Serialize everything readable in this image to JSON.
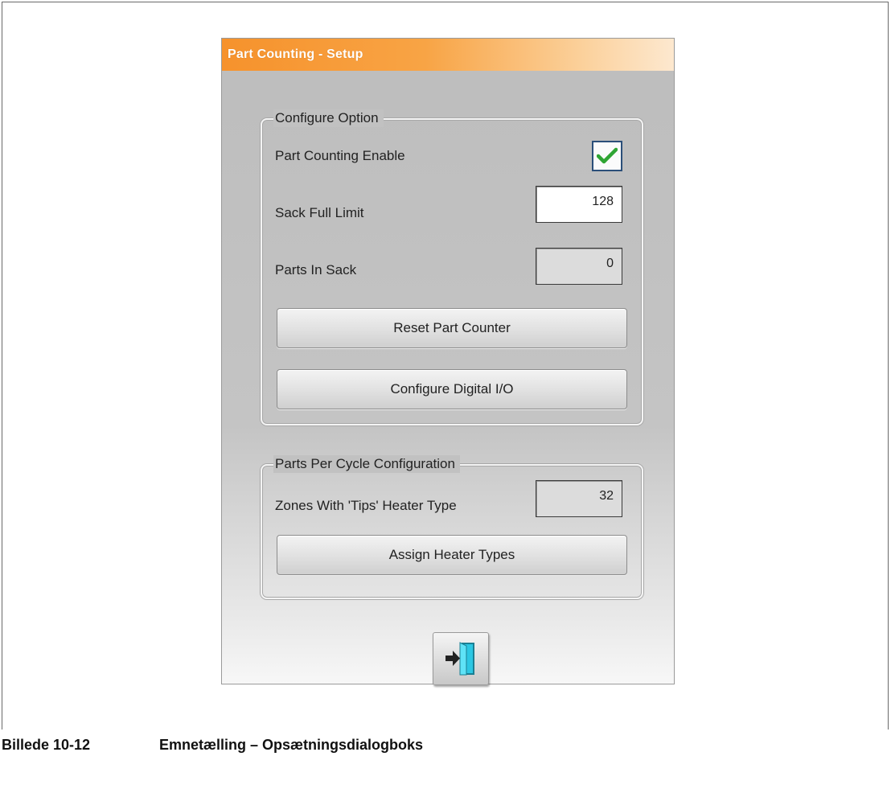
{
  "dialog": {
    "title": "Part Counting - Setup",
    "configure_group": {
      "legend": "Configure Option",
      "enable_label": "Part Counting Enable",
      "enable_checked": true,
      "sack_full_label": "Sack Full Limit",
      "sack_full_value": "128",
      "parts_in_sack_label": "Parts In Sack",
      "parts_in_sack_value": "0",
      "reset_button": "Reset Part Counter",
      "digital_io_button": "Configure Digital I/O"
    },
    "ppc_group": {
      "legend": "Parts Per Cycle Configuration",
      "zones_label": "Zones With 'Tips' Heater Type",
      "zones_value": "32",
      "assign_button": "Assign Heater Types"
    },
    "exit_icon": "exit-door-icon"
  },
  "caption": {
    "number": "Billede 10-12",
    "text": "Emnetælling – Opsætningsdialogboks"
  },
  "colors": {
    "title_gradient_start": "#f6922c",
    "checkmark": "#2fa533",
    "checkbox_border": "#2b4f79",
    "door": "#2cc7e3"
  }
}
